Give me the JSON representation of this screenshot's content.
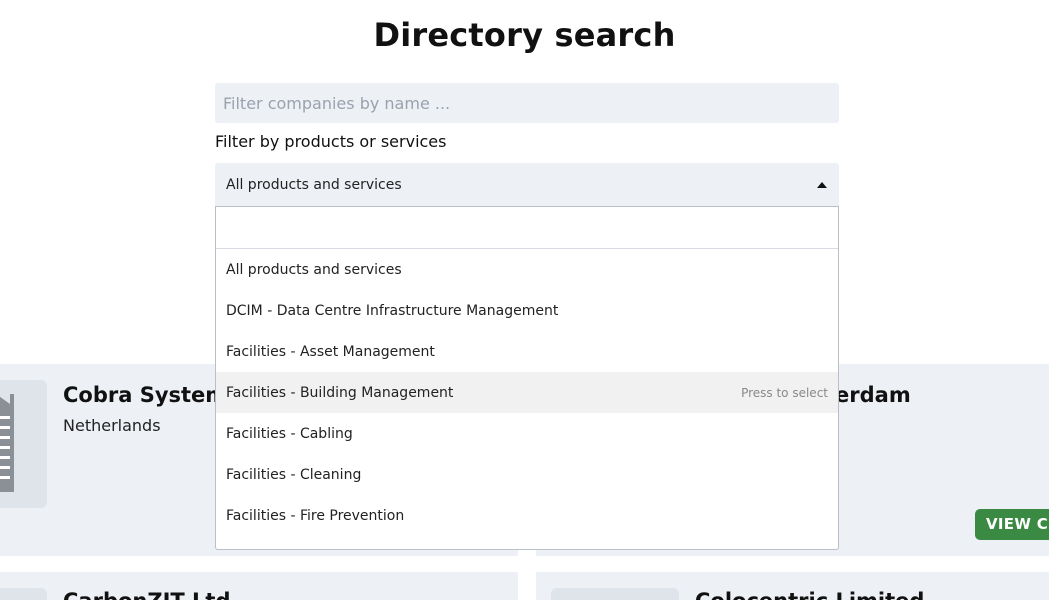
{
  "page": {
    "title": "Directory search"
  },
  "filters": {
    "name_placeholder": "Filter companies by name ...",
    "name_value": "",
    "products_label": "Filter by products or services",
    "products_selected": "All products and services",
    "dropdown_search_value": ""
  },
  "dropdown": {
    "options": [
      {
        "label": "All products and services"
      },
      {
        "label": "DCIM - Data Centre Infrastructure Management"
      },
      {
        "label": "Facilities - Asset Management"
      },
      {
        "label": "Facilities - Building Management",
        "hint": "Press to select"
      },
      {
        "label": "Facilities - Cabling"
      },
      {
        "label": "Facilities - Cleaning"
      },
      {
        "label": "Facilities - Fire Prevention"
      }
    ]
  },
  "cards": {
    "row1_left_name": "Cobra Systems",
    "row1_left_country": "Netherlands",
    "row1_right_name": "terdam",
    "row1_right_button": "VIEW C",
    "row2_left_name": "CarbonZIT Ltd",
    "row2_right_name": "Colocentric Limited"
  },
  "colors": {
    "accent_button": "#3a8a44",
    "field_background": "#edf0f5"
  },
  "icons": {
    "caret": "caret-up-icon",
    "logo": "building-icon"
  }
}
